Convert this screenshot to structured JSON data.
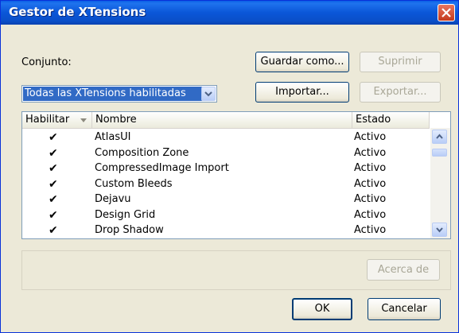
{
  "window": {
    "title": "Gestor de XTensions"
  },
  "set": {
    "label": "Conjunto:",
    "selected": "Todas las XTensions habilitadas"
  },
  "buttons": {
    "save_as": "Guardar como...",
    "delete": "Suprimir",
    "import": "Importar...",
    "export": "Exportar...",
    "about": "Acerca de",
    "ok": "OK",
    "cancel": "Cancelar"
  },
  "table": {
    "columns": [
      "Habilitar",
      "Nombre",
      "Estado"
    ],
    "rows": [
      {
        "enabled": true,
        "name": "AtlasUI",
        "status": "Activo"
      },
      {
        "enabled": true,
        "name": "Composition Zone",
        "status": "Activo"
      },
      {
        "enabled": true,
        "name": "CompressedImage Import",
        "status": "Activo"
      },
      {
        "enabled": true,
        "name": "Custom Bleeds",
        "status": "Activo"
      },
      {
        "enabled": true,
        "name": "Dejavu",
        "status": "Activo"
      },
      {
        "enabled": true,
        "name": "Design Grid",
        "status": "Activo"
      },
      {
        "enabled": true,
        "name": "Drop Shadow",
        "status": "Activo"
      }
    ]
  },
  "icons": {
    "close": "close-icon",
    "combo_arrow": "chevron-down-icon",
    "sort": "sort-arrow-icon",
    "check": "checkmark-icon"
  },
  "colors": {
    "title_bar": "#0a56d8",
    "selection": "#316ac5",
    "close": "#c4391c"
  }
}
